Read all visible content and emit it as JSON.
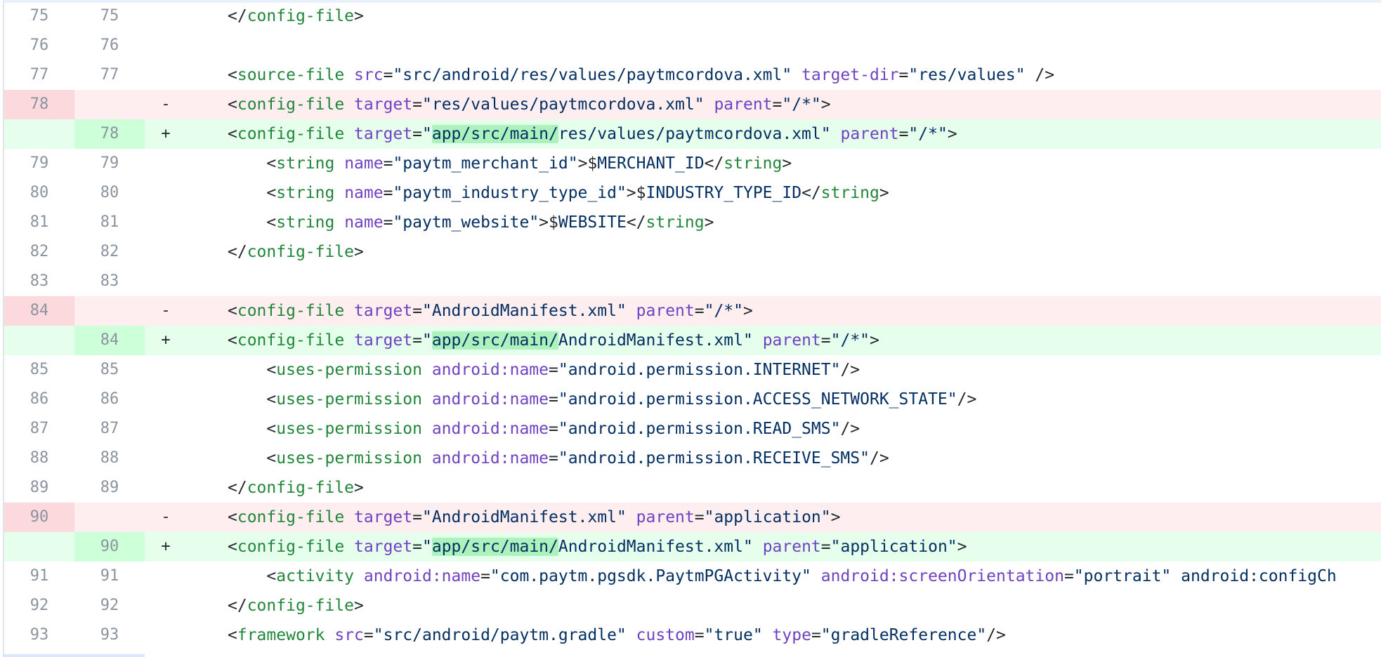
{
  "diff": {
    "lines": [
      {
        "type": "ctx",
        "old": "75",
        "new": "75",
        "marker": "",
        "code": "</config-file>"
      },
      {
        "type": "ctx",
        "old": "76",
        "new": "76",
        "marker": "",
        "code": ""
      },
      {
        "type": "ctx",
        "old": "77",
        "new": "77",
        "marker": "",
        "code": "<source-file src=\"src/android/res/values/paytmcordova.xml\" target-dir=\"res/values\" />"
      },
      {
        "type": "del",
        "old": "78",
        "new": "",
        "marker": "-",
        "code": "<config-file target=\"res/values/paytmcordova.xml\" parent=\"/*\">"
      },
      {
        "type": "add",
        "old": "",
        "new": "78",
        "marker": "+",
        "code": "<config-file target=\"app/src/main/res/values/paytmcordova.xml\" parent=\"/*\">"
      },
      {
        "type": "ctx",
        "old": "79",
        "new": "79",
        "marker": "",
        "code": "    <string name=\"paytm_merchant_id\">$MERCHANT_ID</string>"
      },
      {
        "type": "ctx",
        "old": "80",
        "new": "80",
        "marker": "",
        "code": "    <string name=\"paytm_industry_type_id\">$INDUSTRY_TYPE_ID</string>"
      },
      {
        "type": "ctx",
        "old": "81",
        "new": "81",
        "marker": "",
        "code": "    <string name=\"paytm_website\">$WEBSITE</string>"
      },
      {
        "type": "ctx",
        "old": "82",
        "new": "82",
        "marker": "",
        "code": "</config-file>"
      },
      {
        "type": "ctx",
        "old": "83",
        "new": "83",
        "marker": "",
        "code": ""
      },
      {
        "type": "del",
        "old": "84",
        "new": "",
        "marker": "-",
        "code": "<config-file target=\"AndroidManifest.xml\" parent=\"/*\">"
      },
      {
        "type": "add",
        "old": "",
        "new": "84",
        "marker": "+",
        "code": "<config-file target=\"app/src/main/AndroidManifest.xml\" parent=\"/*\">"
      },
      {
        "type": "ctx",
        "old": "85",
        "new": "85",
        "marker": "",
        "code": "    <uses-permission android:name=\"android.permission.INTERNET\"/>"
      },
      {
        "type": "ctx",
        "old": "86",
        "new": "86",
        "marker": "",
        "code": "    <uses-permission android:name=\"android.permission.ACCESS_NETWORK_STATE\"/>"
      },
      {
        "type": "ctx",
        "old": "87",
        "new": "87",
        "marker": "",
        "code": "    <uses-permission android:name=\"android.permission.READ_SMS\"/>"
      },
      {
        "type": "ctx",
        "old": "88",
        "new": "88",
        "marker": "",
        "code": "    <uses-permission android:name=\"android.permission.RECEIVE_SMS\"/>"
      },
      {
        "type": "ctx",
        "old": "89",
        "new": "89",
        "marker": "",
        "code": "</config-file>"
      },
      {
        "type": "del",
        "old": "90",
        "new": "",
        "marker": "-",
        "code": "<config-file target=\"AndroidManifest.xml\" parent=\"application\">"
      },
      {
        "type": "add",
        "old": "",
        "new": "90",
        "marker": "+",
        "code": "<config-file target=\"app/src/main/AndroidManifest.xml\" parent=\"application\">"
      },
      {
        "type": "ctx",
        "old": "91",
        "new": "91",
        "marker": "",
        "code": "    <activity android:name=\"com.paytm.pgsdk.PaytmPGActivity\" android:screenOrientation=\"portrait\" android:configCh"
      },
      {
        "type": "ctx",
        "old": "92",
        "new": "92",
        "marker": "",
        "code": "</config-file>"
      },
      {
        "type": "ctx",
        "old": "93",
        "new": "93",
        "marker": "",
        "code": "<framework src=\"src/android/paytm.gradle\" custom=\"true\" type=\"gradleReference\"/>"
      }
    ],
    "highlight": "app/src/main/"
  }
}
